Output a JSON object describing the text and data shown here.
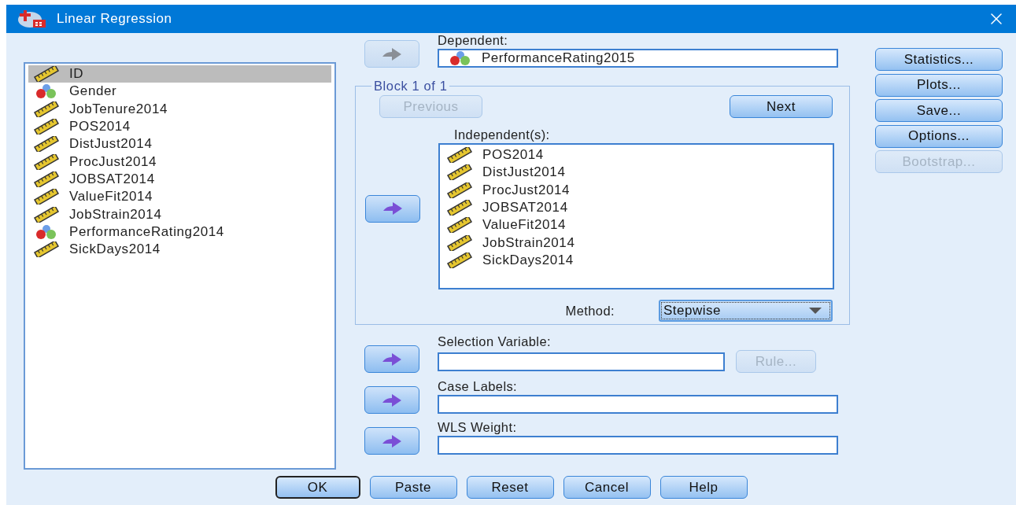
{
  "window": {
    "title": "Linear Regression"
  },
  "variables": [
    {
      "name": "ID",
      "kind": "scale",
      "selected": true
    },
    {
      "name": "Gender",
      "kind": "nominal",
      "selected": false
    },
    {
      "name": "JobTenure2014",
      "kind": "scale",
      "selected": false
    },
    {
      "name": "POS2014",
      "kind": "scale",
      "selected": false
    },
    {
      "name": "DistJust2014",
      "kind": "scale",
      "selected": false
    },
    {
      "name": "ProcJust2014",
      "kind": "scale",
      "selected": false
    },
    {
      "name": "JOBSAT2014",
      "kind": "scale",
      "selected": false
    },
    {
      "name": "ValueFit2014",
      "kind": "scale",
      "selected": false
    },
    {
      "name": "JobStrain2014",
      "kind": "scale",
      "selected": false
    },
    {
      "name": "PerformanceRating2014",
      "kind": "nominal",
      "selected": false
    },
    {
      "name": "SickDays2014",
      "kind": "scale",
      "selected": false
    }
  ],
  "dependent": {
    "label": "Dependent:",
    "arrow": {
      "disabled": true
    },
    "value": {
      "name": "PerformanceRating2015",
      "kind": "nominal"
    }
  },
  "block": {
    "title": "Block 1 of 1",
    "previous": {
      "label": "Previous",
      "disabled": true
    },
    "next": {
      "label": "Next",
      "disabled": false
    },
    "independents_label": "Independent(s):",
    "arrow": {
      "disabled": false
    },
    "independents": [
      {
        "name": "POS2014",
        "kind": "scale"
      },
      {
        "name": "DistJust2014",
        "kind": "scale"
      },
      {
        "name": "ProcJust2014",
        "kind": "scale"
      },
      {
        "name": "JOBSAT2014",
        "kind": "scale"
      },
      {
        "name": "ValueFit2014",
        "kind": "scale"
      },
      {
        "name": "JobStrain2014",
        "kind": "scale"
      },
      {
        "name": "SickDays2014",
        "kind": "scale"
      }
    ],
    "method_label": "Method:",
    "method": "Stepwise"
  },
  "selection_variable": {
    "label": "Selection Variable:",
    "arrow": {
      "disabled": false
    },
    "rule": {
      "label": "Rule...",
      "disabled": true
    }
  },
  "case_labels": {
    "label": "Case Labels:",
    "arrow": {
      "disabled": false
    }
  },
  "wls_weight": {
    "label": "WLS Weight:",
    "arrow": {
      "disabled": false
    }
  },
  "side_buttons": [
    {
      "label": "Statistics...",
      "disabled": false
    },
    {
      "label": "Plots...",
      "disabled": false
    },
    {
      "label": "Save...",
      "disabled": false
    },
    {
      "label": "Options...",
      "disabled": false
    },
    {
      "label": "Bootstrap...",
      "disabled": true
    }
  ],
  "buttons": [
    {
      "label": "OK",
      "default": true
    },
    {
      "label": "Paste",
      "default": false
    },
    {
      "label": "Reset",
      "default": false
    },
    {
      "label": "Cancel",
      "default": false
    },
    {
      "label": "Help",
      "default": false
    }
  ]
}
